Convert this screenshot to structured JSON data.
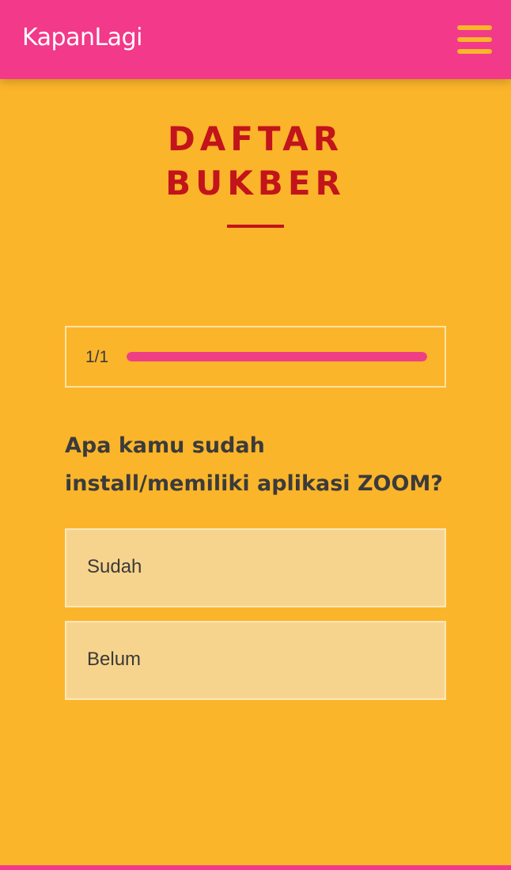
{
  "header": {
    "logo_text": "KapanLagi",
    "menu_icon": "hamburger-menu-icon",
    "background_color": "#f2398a",
    "accent_color": "#fbb52a"
  },
  "page": {
    "title_line_1": "DAFTAR",
    "title_line_2": "BUKBER",
    "title_color": "#c2141b",
    "background_color": "#fbb52a"
  },
  "progress": {
    "label": "1/1",
    "value": 1.0,
    "fill_color": "#ef3f84"
  },
  "question": {
    "line_1": "Apa kamu sudah",
    "line_2": "install/memiliki aplikasi ZOOM?"
  },
  "options": [
    {
      "label": "Sudah"
    },
    {
      "label": "Belum"
    }
  ]
}
